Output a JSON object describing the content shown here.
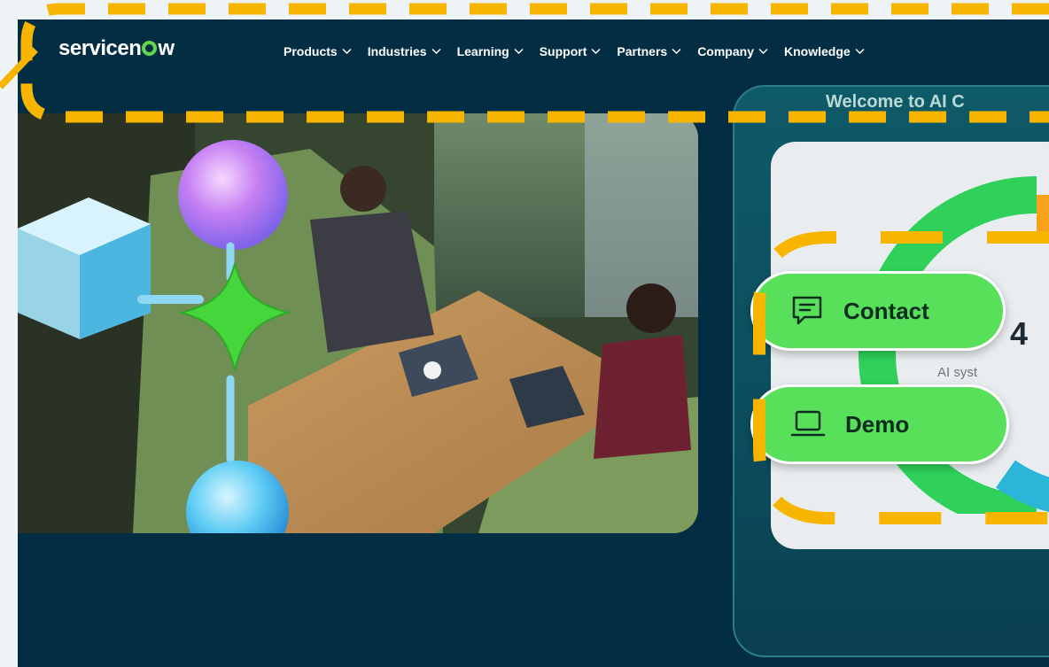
{
  "brand": {
    "name_pre": "servicen",
    "name_post": "w",
    "accent": "#62d84e"
  },
  "nav": {
    "items": [
      {
        "label": "Products"
      },
      {
        "label": "Industries"
      },
      {
        "label": "Learning"
      },
      {
        "label": "Support"
      },
      {
        "label": "Partners"
      },
      {
        "label": "Company"
      },
      {
        "label": "Knowledge"
      }
    ]
  },
  "ai_panel": {
    "title": "Welcome to AI C",
    "caption": "AI syst",
    "number": "4"
  },
  "cta": {
    "contact_label": "Contact",
    "demo_label": "Demo",
    "color": "#59e05a"
  },
  "colors": {
    "background": "#032d42",
    "annotation": "#f7b500"
  }
}
